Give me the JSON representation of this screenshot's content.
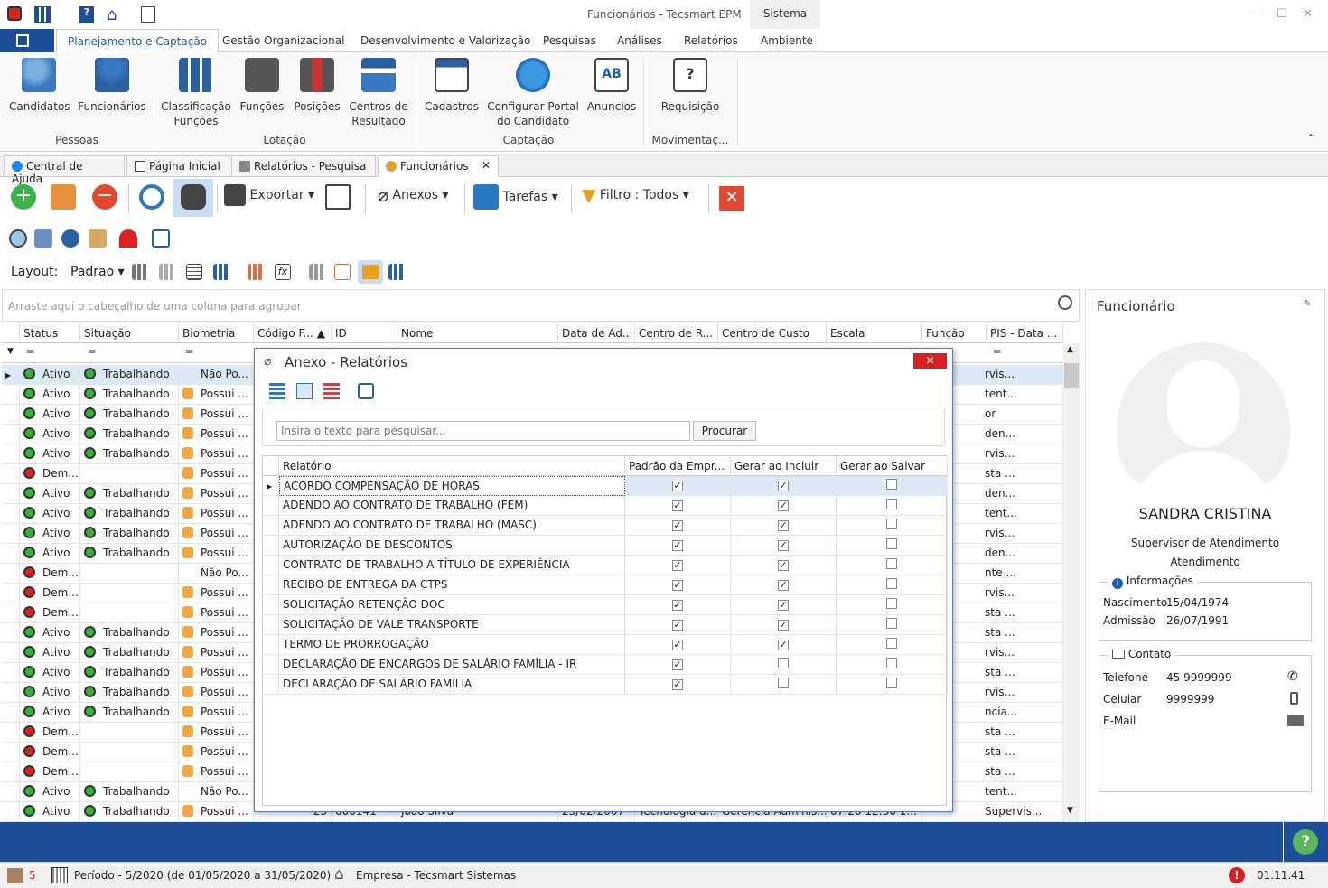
{
  "window": {
    "title": "Funcionários - Tecsmart EPM",
    "context_tab": "Sistema"
  },
  "ribbon_tabs": [
    "Planejamento e Captação",
    "Gestão Organizacional",
    "Desenvolvimento e Valorização",
    "Pesquisas",
    "Análises",
    "Relatórios",
    "Ambiente"
  ],
  "ribbon": {
    "buttons": [
      {
        "label": "Candidatos"
      },
      {
        "label": "Funcionários"
      },
      {
        "label": "Classificação\nFunções"
      },
      {
        "label": "Funções"
      },
      {
        "label": "Posições"
      },
      {
        "label": "Centros de\nResultado"
      },
      {
        "label": "Cadastros"
      },
      {
        "label": "Configurar Portal\ndo Candidato"
      },
      {
        "label": "Anuncios"
      },
      {
        "label": "Requisição"
      }
    ],
    "groups": [
      "Pessoas",
      "Lotação",
      "Captação",
      "Movimentaç..."
    ]
  },
  "doc_tabs": [
    "Central de Ajuda",
    "Página Inicial",
    "Relatórios - Pesquisa",
    "Funcionários"
  ],
  "toolbar": {
    "export": "Exportar",
    "attachments": "Anexos",
    "tasks": "Tarefas",
    "filter": "Filtro : Todos"
  },
  "layout": {
    "label": "Layout:",
    "value": "Padrao"
  },
  "group_area": "Arraste aqui o cabeçalho de uma coluna para agrupar",
  "grid": {
    "columns": [
      "Status",
      "Situação",
      "Biometria",
      "Código F...",
      "ID",
      "Nome",
      "Data de Ad...",
      "Centro de R...",
      "Centro de Custo",
      "Escala",
      "Função",
      "PIS - Data ..."
    ],
    "rows": [
      {
        "status": "Ativo",
        "st": "g",
        "situacao": "Trabalhando",
        "bio": "Não Po...",
        "hand": false,
        "pis": "rvis..."
      },
      {
        "status": "Ativo",
        "st": "g",
        "situacao": "Trabalhando",
        "bio": "Possui ...",
        "hand": true,
        "pis": "tent..."
      },
      {
        "status": "Ativo",
        "st": "g",
        "situacao": "Trabalhando",
        "bio": "Possui ...",
        "hand": true,
        "pis": "or"
      },
      {
        "status": "Ativo",
        "st": "g",
        "situacao": "Trabalhando",
        "bio": "Possui ...",
        "hand": true,
        "pis": "den..."
      },
      {
        "status": "Ativo",
        "st": "g",
        "situacao": "Trabalhando",
        "bio": "Possui ...",
        "hand": true,
        "pis": "rvis..."
      },
      {
        "status": "Dem...",
        "st": "r",
        "situacao": "",
        "bio": "Possui ...",
        "hand": true,
        "pis": "sta ..."
      },
      {
        "status": "Ativo",
        "st": "g",
        "situacao": "Trabalhando",
        "bio": "Possui ...",
        "hand": true,
        "pis": "den..."
      },
      {
        "status": "Ativo",
        "st": "g",
        "situacao": "Trabalhando",
        "bio": "Possui ...",
        "hand": true,
        "pis": "tent..."
      },
      {
        "status": "Ativo",
        "st": "g",
        "situacao": "Trabalhando",
        "bio": "Possui ...",
        "hand": true,
        "pis": "rvis..."
      },
      {
        "status": "Ativo",
        "st": "g",
        "situacao": "Trabalhando",
        "bio": "Possui ...",
        "hand": true,
        "pis": "den..."
      },
      {
        "status": "Dem...",
        "st": "r",
        "situacao": "",
        "bio": "Não Po...",
        "hand": false,
        "pis": "nte ..."
      },
      {
        "status": "Dem...",
        "st": "r",
        "situacao": "",
        "bio": "Possui ...",
        "hand": true,
        "pis": "rvis..."
      },
      {
        "status": "Dem...",
        "st": "r",
        "situacao": "",
        "bio": "Possui ...",
        "hand": true,
        "pis": "sta ..."
      },
      {
        "status": "Ativo",
        "st": "g",
        "situacao": "Trabalhando",
        "bio": "Possui ...",
        "hand": true,
        "pis": "sta ..."
      },
      {
        "status": "Ativo",
        "st": "g",
        "situacao": "Trabalhando",
        "bio": "Possui ...",
        "hand": true,
        "pis": "rvis..."
      },
      {
        "status": "Ativo",
        "st": "g",
        "situacao": "Trabalhando",
        "bio": "Possui ...",
        "hand": true,
        "pis": "sta ..."
      },
      {
        "status": "Ativo",
        "st": "g",
        "situacao": "Trabalhando",
        "bio": "Possui ...",
        "hand": true,
        "pis": "rvis..."
      },
      {
        "status": "Ativo",
        "st": "g",
        "situacao": "Trabalhando",
        "bio": "Possui ...",
        "hand": true,
        "pis": "ncia..."
      },
      {
        "status": "Dem...",
        "st": "r",
        "situacao": "",
        "bio": "Possui ...",
        "hand": true,
        "pis": "sta ..."
      },
      {
        "status": "Dem...",
        "st": "r",
        "situacao": "",
        "bio": "Possui ...",
        "hand": true,
        "pis": "sta ..."
      },
      {
        "status": "Dem...",
        "st": "r",
        "situacao": "",
        "bio": "Possui ...",
        "hand": true,
        "pis": "sta ..."
      },
      {
        "status": "Ativo",
        "st": "g",
        "situacao": "Trabalhando",
        "bio": "Não Po...",
        "hand": false,
        "pis": "tent..."
      },
      {
        "status": "Ativo",
        "st": "g",
        "situacao": "Trabalhando",
        "bio": "Possui ...",
        "hand": true,
        "pis": "Supervis..."
      }
    ],
    "last_row_partial": {
      "codigo": "23",
      "id": "000141",
      "nome": "João Silva",
      "data": "23/02/2007",
      "centro_r": "Tecnologia d...",
      "centro_c": "Gerencia Adminis...",
      "escala": "07:20 12:30 1..."
    }
  },
  "dialog": {
    "title": "Anexo - Relatórios",
    "search_placeholder": "Insira o texto para pesquisar...",
    "search_button": "Procurar",
    "columns": [
      "Relatório",
      "Padrão da Empr...",
      "Gerar ao Incluir",
      "Gerar ao Salvar"
    ],
    "rows": [
      {
        "name": "ACORDO COMPENSAÇÃO DE HORAS",
        "padrao": true,
        "incluir": true,
        "salvar": false
      },
      {
        "name": "ADENDO AO CONTRATO DE TRABALHO (FEM)",
        "padrao": true,
        "incluir": true,
        "salvar": false
      },
      {
        "name": "ADENDO AO CONTRATO DE TRABALHO (MASC)",
        "padrao": true,
        "incluir": true,
        "salvar": false
      },
      {
        "name": "AUTORIZAÇÃO DE DESCONTOS",
        "padrao": true,
        "incluir": true,
        "salvar": false
      },
      {
        "name": "CONTRATO DE TRABALHO A TÍTULO DE EXPERIÊNCIA",
        "padrao": true,
        "incluir": true,
        "salvar": false
      },
      {
        "name": "RECIBO DE ENTREGA DA CTPS",
        "padrao": true,
        "incluir": true,
        "salvar": false
      },
      {
        "name": "SOLICITAÇÃO RETENÇÃO DOC",
        "padrao": true,
        "incluir": true,
        "salvar": false
      },
      {
        "name": "SOLICITAÇÃO DE VALE TRANSPORTE",
        "padrao": true,
        "incluir": true,
        "salvar": false
      },
      {
        "name": "TERMO  DE  PRORROGAÇÃO",
        "padrao": true,
        "incluir": true,
        "salvar": false
      },
      {
        "name": "DECLARAÇÃO DE ENCARGOS DE SALÁRIO FAMÍLIA - IR",
        "padrao": true,
        "incluir": false,
        "salvar": false
      },
      {
        "name": "DECLARAÇÃO DE SALÁRIO FAMÍLIA",
        "padrao": true,
        "incluir": false,
        "salvar": false
      }
    ]
  },
  "employee_panel": {
    "title": "Funcionário",
    "name": "SANDRA CRISTINA",
    "role_line1": "Supervisor de Atendimento",
    "role_line2": "Atendimento",
    "info_title": "Informações",
    "birth_label": "Nascimento",
    "birth": "15/04/1974",
    "admission_label": "Admissão",
    "admission": "26/07/1991",
    "contact_title": "Contato",
    "phone_label": "Telefone",
    "phone": "45 9999999",
    "cell_label": "Celular",
    "cell": "9999999",
    "email_label": "E-Mail"
  },
  "status": {
    "alerts": "5",
    "period": "Período - 5/2020 (de 01/05/2020 a 31/05/2020)",
    "company": "Empresa - Tecsmart Sistemas",
    "version": "01.11.41"
  }
}
